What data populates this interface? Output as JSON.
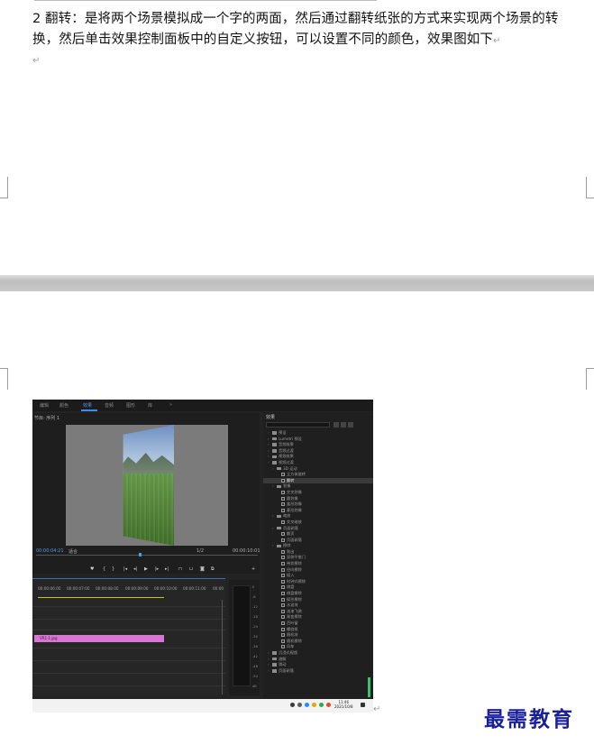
{
  "document": {
    "paragraph": "2 翻转：是将两个场景模拟成一个字的两面，然后通过翻转纸张的方式来实现两个场景的转换，然后单击效果控制面板中的自定义按钮，可以设置不同的颜色，效果图如下",
    "return_mark": "↵"
  },
  "screenshot": {
    "menu": [
      "编辑",
      "颜色",
      "效果",
      "音频",
      "图形",
      "库"
    ],
    "active_menu": "效果",
    "monitor_tab": "节目: 序列 1",
    "timecode_current": "00:00:04:21",
    "fit_label": "适合",
    "zoom_label": "1/2",
    "timecode_total": "00:00:10:01",
    "timeline_ticks": [
      "00:00:06:00",
      "00:00:07:00",
      "00:00:08:00",
      "00:00:09:00",
      "00:00:10:00",
      "00:00:11:00",
      "00:00"
    ],
    "clip_label": "VR1-1.jpg",
    "meter_db": [
      "0",
      "-6",
      "-12",
      "-18",
      "-24",
      "-30",
      "-36",
      "-42",
      "-48",
      "-54",
      "dB"
    ],
    "effects_panel_title": "效果",
    "effects_list": [
      {
        "label": "预设",
        "kind": "folder",
        "indent": 0
      },
      {
        "label": "Lumetri 预设",
        "kind": "folder",
        "indent": 0
      },
      {
        "label": "音频效果",
        "kind": "folder",
        "indent": 0
      },
      {
        "label": "音频过渡",
        "kind": "folder",
        "indent": 0
      },
      {
        "label": "视频效果",
        "kind": "folder",
        "indent": 0
      },
      {
        "label": "视频过渡",
        "kind": "folder",
        "indent": 0
      },
      {
        "label": "3D 运动",
        "kind": "folder",
        "indent": 1
      },
      {
        "label": "立方体旋转",
        "kind": "item",
        "indent": 2
      },
      {
        "label": "翻转",
        "kind": "item",
        "indent": 2,
        "selected": true
      },
      {
        "label": "划像",
        "kind": "folder",
        "indent": 1
      },
      {
        "label": "交叉划像",
        "kind": "item",
        "indent": 2
      },
      {
        "label": "圆划像",
        "kind": "item",
        "indent": 2
      },
      {
        "label": "盒形划像",
        "kind": "item",
        "indent": 2
      },
      {
        "label": "菱形划像",
        "kind": "item",
        "indent": 2
      },
      {
        "label": "缩放",
        "kind": "folder",
        "indent": 1
      },
      {
        "label": "交叉缩放",
        "kind": "item",
        "indent": 2
      },
      {
        "label": "页面剥落",
        "kind": "folder",
        "indent": 1
      },
      {
        "label": "翻页",
        "kind": "item",
        "indent": 2
      },
      {
        "label": "页面剥落",
        "kind": "item",
        "indent": 2
      },
      {
        "label": "擦除",
        "kind": "folder",
        "indent": 1
      },
      {
        "label": "划出",
        "kind": "item",
        "indent": 2
      },
      {
        "label": "双侧平推门",
        "kind": "item",
        "indent": 2
      },
      {
        "label": "带状擦除",
        "kind": "item",
        "indent": 2
      },
      {
        "label": "径向擦除",
        "kind": "item",
        "indent": 2
      },
      {
        "label": "插入",
        "kind": "item",
        "indent": 2
      },
      {
        "label": "时钟式擦除",
        "kind": "item",
        "indent": 2
      },
      {
        "label": "棋盘",
        "kind": "item",
        "indent": 2
      },
      {
        "label": "棋盘擦除",
        "kind": "item",
        "indent": 2
      },
      {
        "label": "楔形擦除",
        "kind": "item",
        "indent": 2
      },
      {
        "label": "水波块",
        "kind": "item",
        "indent": 2
      },
      {
        "label": "油漆飞溅",
        "kind": "item",
        "indent": 2
      },
      {
        "label": "渐变擦除",
        "kind": "item",
        "indent": 2
      },
      {
        "label": "百叶窗",
        "kind": "item",
        "indent": 2
      },
      {
        "label": "螺旋框",
        "kind": "item",
        "indent": 2
      },
      {
        "label": "随机块",
        "kind": "item",
        "indent": 2
      },
      {
        "label": "随机擦除",
        "kind": "item",
        "indent": 2
      },
      {
        "label": "风车",
        "kind": "item",
        "indent": 2
      },
      {
        "label": "沉浸式视频",
        "kind": "folder",
        "indent": 0
      },
      {
        "label": "溶解",
        "kind": "folder",
        "indent": 0
      },
      {
        "label": "滑动",
        "kind": "folder",
        "indent": 0
      },
      {
        "label": "页面剥落",
        "kind": "folder",
        "indent": 0
      }
    ],
    "tray_time": "11:46",
    "tray_date": "2021/10/8"
  },
  "logo_text": "最需教育"
}
